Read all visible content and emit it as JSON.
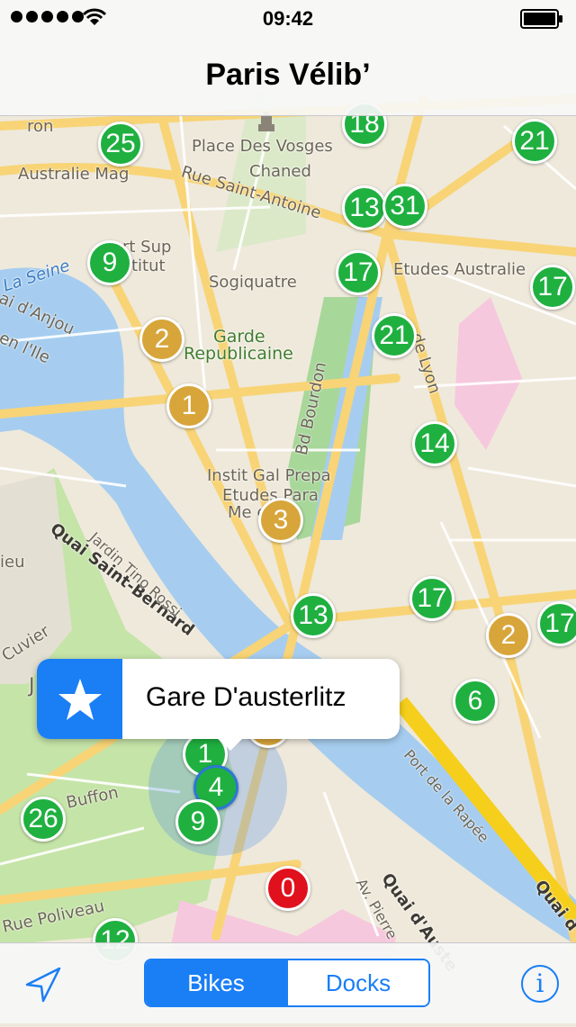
{
  "status_bar": {
    "time": "09:42",
    "signal_icon": "signal-dots-icon",
    "wifi_icon": "wifi-icon",
    "battery_icon": "battery-icon"
  },
  "nav": {
    "title": "Paris Vélib’"
  },
  "map_labels": {
    "place_des_vosges": "Place Des Vosges",
    "chaned": "Chaned",
    "australie_mag": "Australie Mag",
    "rue_saint_antoine": "Rue Saint-Antoine",
    "etudes_australie": "Etudes Australie",
    "art_sup": "rt Sup",
    "titut": "titut",
    "sogiquatre": "Sogiquatre",
    "garde": "Garde",
    "republicaine": "Republicaine",
    "la_seine": "La Seine",
    "quai_anjou": "ai d'Anjou",
    "en_ile": "en l'Ile",
    "ron": "ron",
    "bd_bourdon": "Bd Bourdon",
    "de_lyon": "de Lyon",
    "instit": "Instit Gal Prepa",
    "etudes_para": "Etudes Para",
    "medecine": "Me      es",
    "quai_saint_bernard": "Quai Saint-Bernard",
    "jardin_tino_rossi": "Jardin Tino Rossi",
    "ieu": "ieu",
    "cuvier": "Cuvier",
    "buffon": "Buffon",
    "rue_poliveau": "Rue Poliveau",
    "port_rapee": "Port de la Rapée",
    "quai_austerlitz": "Quai d'Auste",
    "av_pierre": "Av. Pierre",
    "quai_right": "Quai d",
    "j_label": "J"
  },
  "stations": [
    {
      "count": "25",
      "color": "green"
    },
    {
      "count": "18",
      "color": "green"
    },
    {
      "count": "21",
      "color": "green"
    },
    {
      "count": "13",
      "color": "green"
    },
    {
      "count": "31",
      "color": "green"
    },
    {
      "count": "9",
      "color": "green"
    },
    {
      "count": "17",
      "color": "green"
    },
    {
      "count": "17",
      "color": "green"
    },
    {
      "count": "2",
      "color": "orange"
    },
    {
      "count": "21",
      "color": "green"
    },
    {
      "count": "1",
      "color": "orange"
    },
    {
      "count": "14",
      "color": "green"
    },
    {
      "count": "3",
      "color": "orange"
    },
    {
      "count": "13",
      "color": "green"
    },
    {
      "count": "17",
      "color": "green"
    },
    {
      "count": "2",
      "color": "orange"
    },
    {
      "count": "17",
      "color": "green"
    },
    {
      "count": "6",
      "color": "green"
    },
    {
      "count": "1",
      "color": "green"
    },
    {
      "count": "4",
      "color": "green"
    },
    {
      "count": "9",
      "color": "green"
    },
    {
      "count": "26",
      "color": "green"
    },
    {
      "count": "0",
      "color": "red"
    },
    {
      "count": "12",
      "color": "green"
    }
  ],
  "callout": {
    "title": "Gare D'austerlitz",
    "icon": "star-icon"
  },
  "toolbar": {
    "bikes_label": "Bikes",
    "docks_label": "Docks",
    "active_segment": "Bikes",
    "locate_icon": "location-arrow-icon",
    "info_icon": "info-icon",
    "info_glyph": "i"
  },
  "colors": {
    "accent": "#1a7ef5",
    "station_green": "#1fb040",
    "station_orange": "#d7a53a",
    "station_red": "#e0101d",
    "river": "#a6cdef",
    "park": "#c5e4a8",
    "road": "#f8d476"
  }
}
